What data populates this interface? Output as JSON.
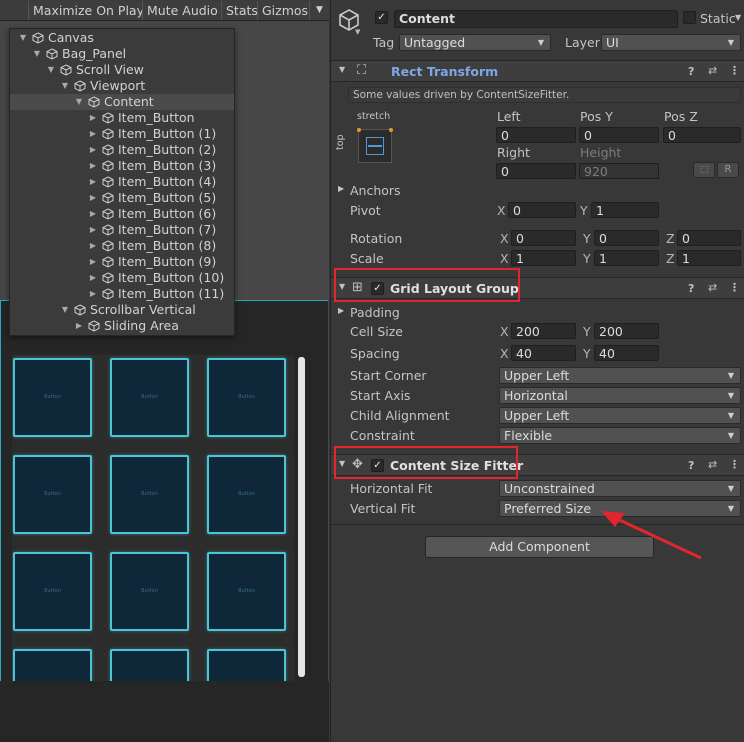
{
  "toolbar": {
    "maximize_on_play": "Maximize On Play",
    "mute_audio": "Mute Audio",
    "stats": "Stats",
    "gizmos": "Gizmos",
    "gizmos_caret": "▼"
  },
  "hierarchy": [
    {
      "label": "Canvas",
      "depth": 0,
      "expanded": true
    },
    {
      "label": "Bag_Panel",
      "depth": 1,
      "expanded": true
    },
    {
      "label": "Scroll View",
      "depth": 2,
      "expanded": true
    },
    {
      "label": "Viewport",
      "depth": 3,
      "expanded": true
    },
    {
      "label": "Content",
      "depth": 4,
      "expanded": true,
      "selected": true
    },
    {
      "label": "Item_Button",
      "depth": 5,
      "expanded": false
    },
    {
      "label": "Item_Button (1)",
      "depth": 5,
      "expanded": false
    },
    {
      "label": "Item_Button (2)",
      "depth": 5,
      "expanded": false
    },
    {
      "label": "Item_Button (3)",
      "depth": 5,
      "expanded": false
    },
    {
      "label": "Item_Button (4)",
      "depth": 5,
      "expanded": false
    },
    {
      "label": "Item_Button (5)",
      "depth": 5,
      "expanded": false
    },
    {
      "label": "Item_Button (6)",
      "depth": 5,
      "expanded": false
    },
    {
      "label": "Item_Button (7)",
      "depth": 5,
      "expanded": false
    },
    {
      "label": "Item_Button (8)",
      "depth": 5,
      "expanded": false
    },
    {
      "label": "Item_Button (9)",
      "depth": 5,
      "expanded": false
    },
    {
      "label": "Item_Button (10)",
      "depth": 5,
      "expanded": false
    },
    {
      "label": "Item_Button (11)",
      "depth": 5,
      "expanded": false
    },
    {
      "label": "Scrollbar Vertical",
      "depth": 3,
      "expanded": true
    },
    {
      "label": "Sliding Area",
      "depth": 4,
      "expanded": false
    }
  ],
  "game_view": {
    "button_text": "Button",
    "cell_count": 12,
    "accent_color": "#49c5d4"
  },
  "inspector": {
    "object_name": "Content",
    "active": true,
    "static_label": "Static",
    "static_caret": "▼",
    "tag_label": "Tag",
    "tag_value": "Untagged",
    "layer_label": "Layer",
    "layer_value": "UI",
    "rect_transform": {
      "title": "Rect Transform",
      "driven_note": "Some values driven by ContentSizeFitter.",
      "anchor_preset_h": "stretch",
      "anchor_preset_v": "top",
      "left_label": "Left",
      "left_value": "0",
      "posy_label": "Pos Y",
      "posy_value": "0",
      "posz_label": "Pos Z",
      "posz_value": "0",
      "right_label": "Right",
      "right_value": "0",
      "height_label": "Height",
      "height_value": "920",
      "r_button": "R",
      "anchors_label": "Anchors",
      "pivot_label": "Pivot",
      "pivot_x": "0",
      "pivot_y": "1",
      "rotation_label": "Rotation",
      "rot_x": "0",
      "rot_y": "0",
      "rot_z": "0",
      "scale_label": "Scale",
      "scale_x": "1",
      "scale_y": "1",
      "scale_z": "1",
      "x": "X",
      "y": "Y",
      "z": "Z"
    },
    "grid_layout_group": {
      "title": "Grid Layout Group",
      "enabled": true,
      "padding_label": "Padding",
      "cell_size_label": "Cell Size",
      "cell_x": "200",
      "cell_y": "200",
      "spacing_label": "Spacing",
      "spacing_x": "40",
      "spacing_y": "40",
      "start_corner_label": "Start Corner",
      "start_corner": "Upper Left",
      "start_axis_label": "Start Axis",
      "start_axis": "Horizontal",
      "child_alignment_label": "Child Alignment",
      "child_alignment": "Upper Left",
      "constraint_label": "Constraint",
      "constraint": "Flexible"
    },
    "content_size_fitter": {
      "title": "Content Size Fitter",
      "enabled": true,
      "horizontal_fit_label": "Horizontal Fit",
      "horizontal_fit": "Unconstrained",
      "vertical_fit_label": "Vertical Fit",
      "vertical_fit": "Preferred Size"
    },
    "add_component": "Add Component"
  },
  "annotation_color": "#e0262f"
}
